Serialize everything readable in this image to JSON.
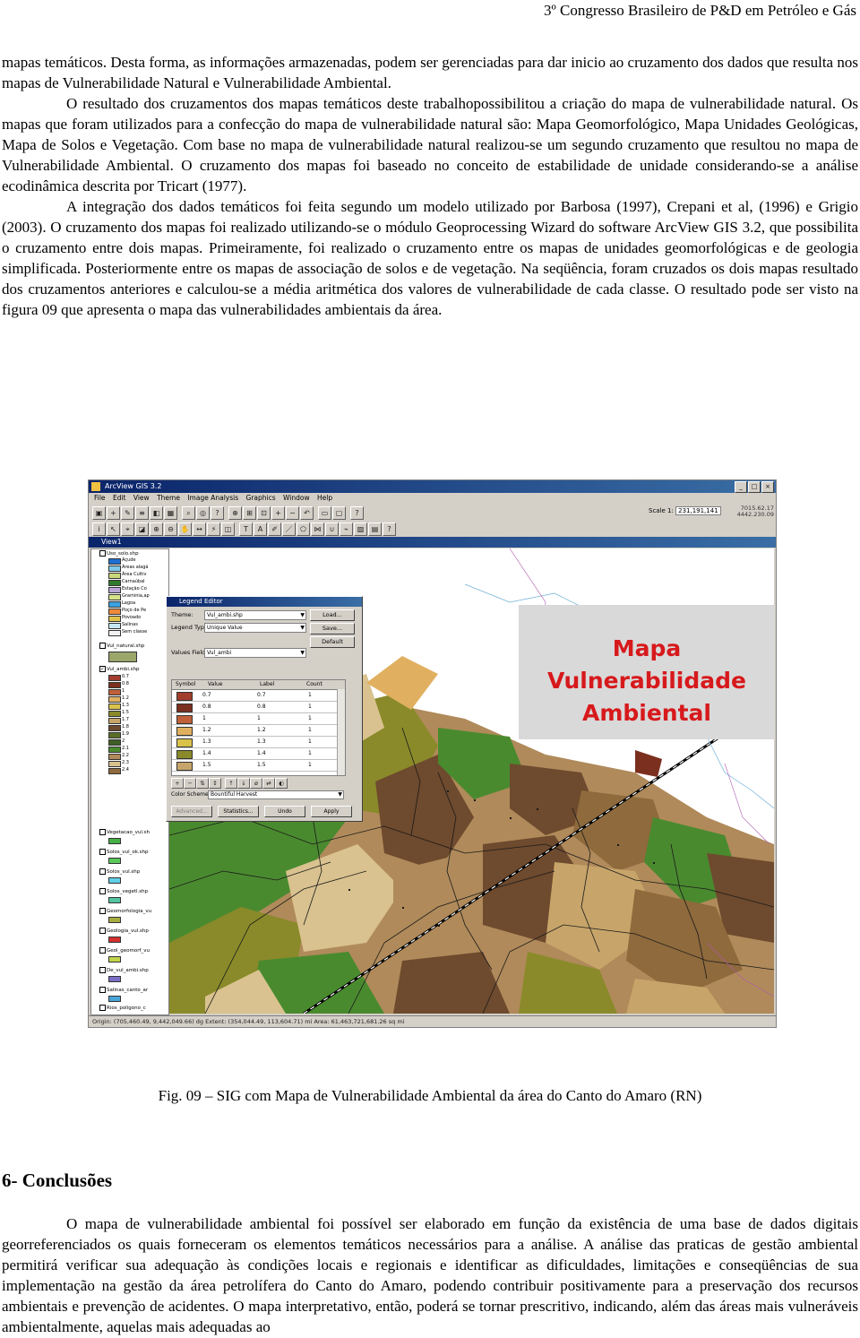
{
  "header": {
    "text": "3º Congresso Brasileiro de P&D em Petróleo e Gás"
  },
  "para_top": [
    "mapas temáticos. Desta forma, as informações armazenadas, podem ser gerenciadas para dar inicio ao cruzamento dos dados que resulta nos mapas de Vulnerabilidade Natural e Vulnerabilidade Ambiental.",
    "O resultado dos cruzamentos dos mapas temáticos deste trabalhopossibilitou a criação do mapa de vulnerabilidade natural. Os mapas que foram utilizados para a confecção do mapa de vulnerabilidade natural são: Mapa Geomorfológico, Mapa Unidades Geológicas, Mapa de Solos e Vegetação. Com base no mapa de vulnerabilidade natural realizou-se um segundo cruzamento que resultou no mapa de Vulnerabilidade Ambiental. O cruzamento dos mapas foi baseado no conceito de estabilidade de unidade considerando-se a análise ecodinâmica descrita por Tricart (1977).",
    "A integração dos dados temáticos foi feita segundo um modelo utilizado por Barbosa (1997), Crepani et al, (1996) e Grigio (2003).  O cruzamento dos mapas foi realizado utilizando-se o módulo Geoprocessing Wizard do software ArcView GIS 3.2, que possibilita o cruzamento entre dois mapas. Primeiramente, foi realizado o cruzamento entre os mapas de unidades geomorfológicas e de geologia simplificada. Posteriormente entre os mapas de associação de solos e de vegetação. Na seqüência, foram cruzados os dois mapas resultado dos cruzamentos anteriores e calculou-se a média aritmética dos valores de vulnerabilidade de cada classe. O resultado pode ser visto na figura 09 que apresenta o mapa das vulnerabilidades ambientais da área."
  ],
  "figure": {
    "app_title": "ArcView GIS 3.2",
    "menu": [
      "File",
      "Edit",
      "View",
      "Theme",
      "Image Analysis",
      "Graphics",
      "Window",
      "Help"
    ],
    "scale_label": "Scale 1:",
    "scale_value": "231,191,141",
    "coord_x": "7015.62.17",
    "coord_y": "4442.230.09",
    "view_title": "View1",
    "overlay_title": [
      "Mapa",
      "Vulnerabilidade",
      "Ambiental"
    ],
    "toc": {
      "layers": [
        {
          "name": "Uso_solo.shp",
          "checked": false
        },
        {
          "name": "Vul_natural.shp",
          "checked": false
        },
        {
          "name": "Vul_ambi.shp",
          "checked": true
        },
        {
          "name": "Vegetacao_vul.sh",
          "checked": false
        },
        {
          "name": "Solos_vul_ok.shp",
          "checked": false
        },
        {
          "name": "Solos_vul.shp",
          "checked": false
        },
        {
          "name": "Solos_vegetl.shp",
          "checked": false
        },
        {
          "name": "Geomorfologia_vu",
          "checked": false
        },
        {
          "name": "Geologia_vul.shp",
          "checked": false
        },
        {
          "name": "Geol_geomorf_vu",
          "checked": false
        },
        {
          "name": "De_vul_ambi.shp",
          "checked": false
        },
        {
          "name": "Salinas_canto_ar",
          "checked": false
        },
        {
          "name": "Rios_poligono_c",
          "checked": false
        }
      ],
      "uso_classes": [
        "Açude",
        "Áreas alagá",
        "Área Cultiv",
        "Carnaúbal",
        "Estação Co",
        "Graminia,ap",
        "Lagoa",
        "Poço de Pe",
        "Povoado",
        "Salinas",
        "Sem classe"
      ],
      "vul_values": [
        "0.7",
        "0.8",
        "1",
        "1.2",
        "1.3",
        "1.5",
        "1.7",
        "1.8",
        "1.9",
        "2",
        "2.1",
        "2.2",
        "2.3",
        "2.4"
      ]
    },
    "legend": {
      "title": "Legend Editor",
      "theme_label": "Theme:",
      "theme_value": "Vul_ambi.shp",
      "legend_type_label": "Legend Type:",
      "legend_type_value": "Unique Value",
      "values_field_label": "Values Field:",
      "values_field_value": "Vul_ambi",
      "buttons_right": [
        "Load...",
        "Save...",
        "Default"
      ],
      "columns": [
        "Symbol",
        "Value",
        "Label",
        "Count"
      ],
      "rows": [
        {
          "value": "0.7",
          "label": "0.7",
          "count": "1"
        },
        {
          "value": "0.8",
          "label": "0.8",
          "count": "1"
        },
        {
          "value": "1",
          "label": "1",
          "count": "1"
        },
        {
          "value": "1.2",
          "label": "1.2",
          "count": "1"
        },
        {
          "value": "1.3",
          "label": "1.3",
          "count": "1"
        },
        {
          "value": "1.4",
          "label": "1.4",
          "count": "1"
        },
        {
          "value": "1.5",
          "label": "1.5",
          "count": "1"
        }
      ],
      "color_scheme_label": "Color Schemes:",
      "color_scheme_value": "Bountiful Harvest",
      "buttons_bottom": [
        "Advanced...",
        "Statistics...",
        "Undo",
        "Apply"
      ]
    },
    "status_text": "Origin: (705,460.49, 9,442,049.66) dg  Extent: (354,044.49, 113,604.71) mi  Area: 61,463,721,681.26 sq mi",
    "colors": {
      "green": "#4a8a2f",
      "olive": "#8a8a2a",
      "tan": "#b08a5a",
      "brown": "#6e4a2e",
      "overlay_red": "#d7191c"
    }
  },
  "caption": "Fig. 09 – SIG com Mapa de Vulnerabilidade Ambiental da área do Canto do Amaro (RN)",
  "section_title": "6- Conclusões",
  "para_conc": "O mapa de vulnerabilidade ambiental foi possível ser elaborado em função da existência de uma base de dados digitais georreferenciados os quais forneceram os elementos temáticos necessários para a análise. A análise das praticas de gestão ambiental permitirá verificar sua adequação às condições locais e regionais e identificar as dificuldades, limitações e conseqüências de sua implementação na gestão da área petrolífera do Canto do Amaro, podendo contribuir positivamente para a preservação dos recursos ambientais e prevenção de acidentes. O mapa interpretativo, então, poderá se tornar prescritivo, indicando, além das áreas mais vulneráveis ambientalmente, aquelas mais adequadas ao"
}
